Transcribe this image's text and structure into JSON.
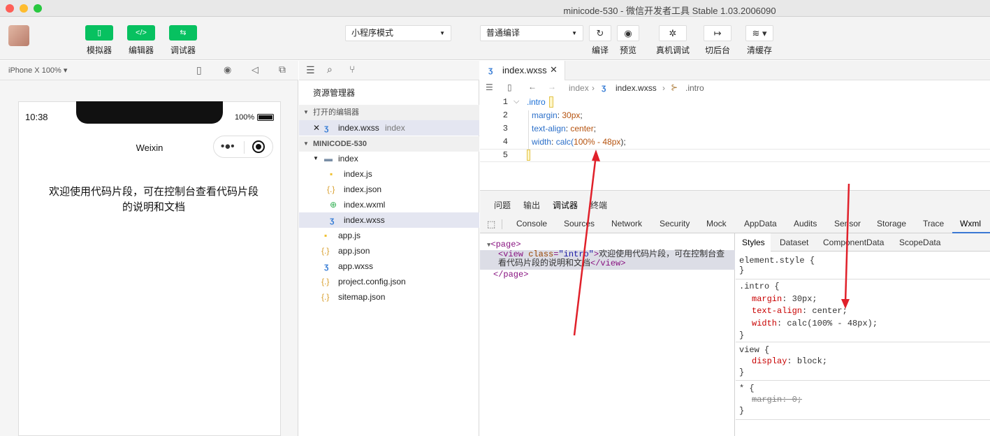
{
  "window": {
    "title": "minicode-530 - 微信开发者工具 Stable 1.03.2006090"
  },
  "toolbar": {
    "simulator_label": "模拟器",
    "editor_label": "编辑器",
    "debugger_label": "调试器",
    "mode_select": "小程序模式",
    "compile_select": "普通编译",
    "compile_label": "编译",
    "preview_label": "预览",
    "remote_debug_label": "真机调试",
    "background_label": "切后台",
    "clear_cache_label": "清缓存"
  },
  "simulator": {
    "device": "iPhone X 100% ▾",
    "time": "10:38",
    "battery": "100%",
    "nav_title": "Weixin",
    "content": "欢迎使用代码片段，可在控制台查看代码片段\n的说明和文档"
  },
  "explorer": {
    "title": "资源管理器",
    "open_editors_label": "打开的编辑器",
    "open_file": "index.wxss",
    "open_file_dir": "index",
    "project_label": "MINICODE-530",
    "folder": "index",
    "files_in_folder": [
      "index.js",
      "index.json",
      "index.wxml",
      "index.wxss"
    ],
    "root_files": [
      "app.js",
      "app.json",
      "app.wxss",
      "project.config.json",
      "sitemap.json"
    ]
  },
  "editor": {
    "tab_label": "index.wxss",
    "breadcrumb": [
      "index",
      "index.wxss",
      ".intro"
    ],
    "line_numbers": [
      "1",
      "2",
      "3",
      "4",
      "5"
    ],
    "code": {
      "selector": ".intro",
      "l2_prop": "margin",
      "l2_val": "30px",
      "l3_prop": "text-align",
      "l3_val": "center",
      "l4_prop": "width",
      "l4_fn": "calc(",
      "l4_arg": "100% - 48px",
      "l4_end": ");"
    }
  },
  "debug": {
    "panel_tabs": [
      "问题",
      "输出",
      "调试器",
      "终端"
    ],
    "devtools_tabs": [
      "Console",
      "Sources",
      "Network",
      "Security",
      "Mock",
      "AppData",
      "Audits",
      "Sensor",
      "Storage",
      "Trace",
      "Wxml"
    ],
    "elements": {
      "page_open": "<page>",
      "view_open": "<view",
      "class_attr": "class",
      "class_val": "\"intro\"",
      "view_text_1": "欢迎使用代码片段，可在控制台查",
      "view_text_2": "看代码片段的说明和文档",
      "view_close": "</view>",
      "page_close": "</page>"
    },
    "style_tabs": [
      "Styles",
      "Dataset",
      "ComponentData",
      "ScopeData"
    ],
    "styles": {
      "element_style": "element.style {",
      "close": "}",
      "intro_sel": ".intro {",
      "intro_margin_p": "margin",
      "intro_margin_v": "30px;",
      "intro_align_p": "text-align",
      "intro_align_v": "center;",
      "intro_width_p": "width",
      "intro_width_v": "calc(100% - 48px);",
      "view_sel": "view {",
      "view_display_p": "display",
      "view_display_v": "block;",
      "star_sel": "* {",
      "star_margin": "margin: 0;"
    }
  },
  "colors": {
    "accent_green": "#07c160",
    "annotation_red": "#e0202a"
  }
}
